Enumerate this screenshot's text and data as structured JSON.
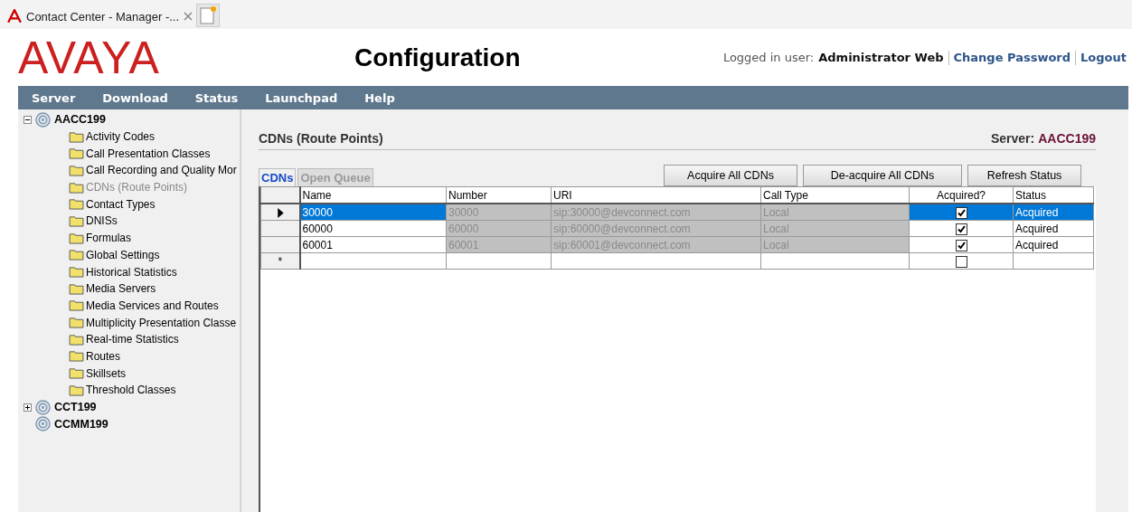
{
  "browser_tab": {
    "title": "Contact Center - Manager -..."
  },
  "header": {
    "logo": "AVAYA",
    "title": "Configuration",
    "user_label": "Logged in user:",
    "user": "Administrator Web",
    "links": [
      "Change Password",
      "Logout"
    ]
  },
  "menu": [
    "Server",
    "Download",
    "Status",
    "Launchpad",
    "Help"
  ],
  "tree": [
    {
      "label": "AACC199",
      "expanded": true,
      "children": [
        {
          "label": "Activity Codes",
          "selected": false
        },
        {
          "label": "Call Presentation Classes",
          "selected": false
        },
        {
          "label": "Call Recording and Quality Mor",
          "selected": false
        },
        {
          "label": "CDNs (Route Points)",
          "selected": true
        },
        {
          "label": "Contact Types",
          "selected": false
        },
        {
          "label": "DNISs",
          "selected": false
        },
        {
          "label": "Formulas",
          "selected": false
        },
        {
          "label": "Global Settings",
          "selected": false
        },
        {
          "label": "Historical Statistics",
          "selected": false
        },
        {
          "label": "Media Servers",
          "selected": false
        },
        {
          "label": "Media Services and Routes",
          "selected": false
        },
        {
          "label": "Multiplicity Presentation Classe",
          "selected": false
        },
        {
          "label": "Real-time Statistics",
          "selected": false
        },
        {
          "label": "Routes",
          "selected": false
        },
        {
          "label": "Skillsets",
          "selected": false
        },
        {
          "label": "Threshold Classes",
          "selected": false
        }
      ]
    },
    {
      "label": "CCT199",
      "expanded": false
    },
    {
      "label": "CCMM199"
    }
  ],
  "panel": {
    "title": "CDNs (Route Points)",
    "server_label": "Server:",
    "server": "AACC199",
    "tabs": [
      {
        "label": "CDNs",
        "selected": true
      },
      {
        "label": "Open Queue",
        "selected": false
      }
    ],
    "buttons": [
      "Acquire All CDNs",
      "De-acquire All CDNs",
      "Refresh Status"
    ],
    "columns": [
      "Name",
      "Number",
      "URI",
      "Call Type",
      "Acquired?",
      "Status"
    ],
    "rows": [
      {
        "selected": true,
        "name": "30000",
        "number": "30000",
        "uri": "sip:30000@devconnect.com",
        "call_type": "Local",
        "acquired": true,
        "status": "Acquired"
      },
      {
        "selected": false,
        "name": "60000",
        "number": "60000",
        "uri": "sip:60000@devconnect.com",
        "call_type": "Local",
        "acquired": true,
        "status": "Acquired"
      },
      {
        "selected": false,
        "name": "60001",
        "number": "60001",
        "uri": "sip:60001@devconnect.com",
        "call_type": "Local",
        "acquired": true,
        "status": "Acquired"
      }
    ],
    "new_row": {
      "marker": "*",
      "acquired": false
    }
  }
}
